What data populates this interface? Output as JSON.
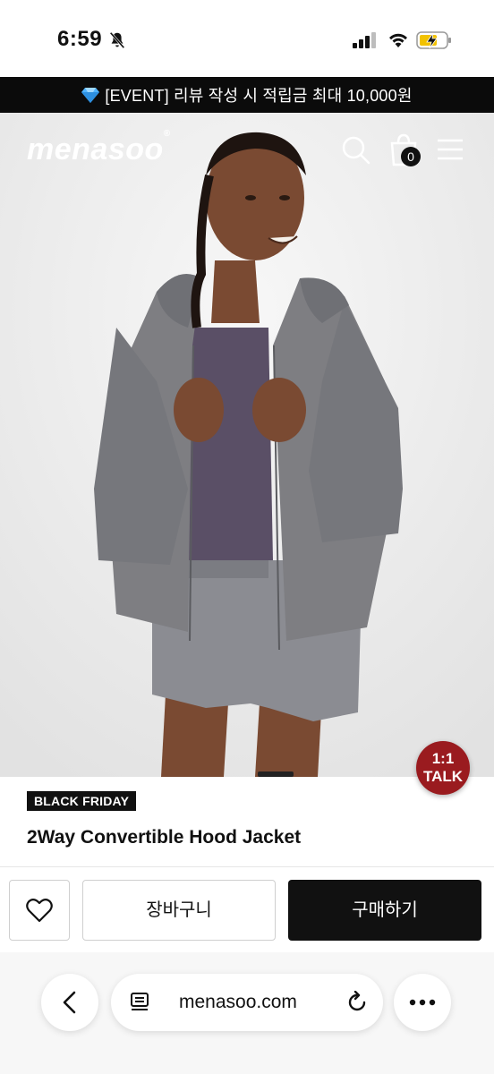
{
  "status_bar": {
    "time": "6:59",
    "icons": [
      "bell-slash-icon",
      "signal-icon",
      "wifi-icon",
      "battery-charging-icon"
    ]
  },
  "event_banner": {
    "text": "[EVENT] 리뷰 작성 시 적립금 최대 10,000원",
    "icon": "gem-icon"
  },
  "header": {
    "logo": "menasoo",
    "logo_mark": "®",
    "cart_count": "0",
    "icons": [
      "search-icon",
      "shopping-bag-icon",
      "menu-icon"
    ]
  },
  "chat": {
    "line1": "1:1",
    "line2": "TALK",
    "color": "#9a1b1f"
  },
  "product": {
    "badge": "BLACK FRIDAY",
    "title": "2Way Convertible Hood Jacket"
  },
  "actions": {
    "wishlist_icon": "heart-outline-icon",
    "cart_label": "장바구니",
    "buy_label": "구매하기"
  },
  "browser": {
    "url": "menasoo.com",
    "icons": [
      "chevron-left-icon",
      "page-icon",
      "reload-icon",
      "more-icon"
    ]
  },
  "colors": {
    "banner_bg": "#0b0b0b",
    "hero_bg": "#ececec",
    "buy_button_bg": "#111111",
    "jacket": "#7e7e82",
    "shirt": "#5a4f66"
  }
}
